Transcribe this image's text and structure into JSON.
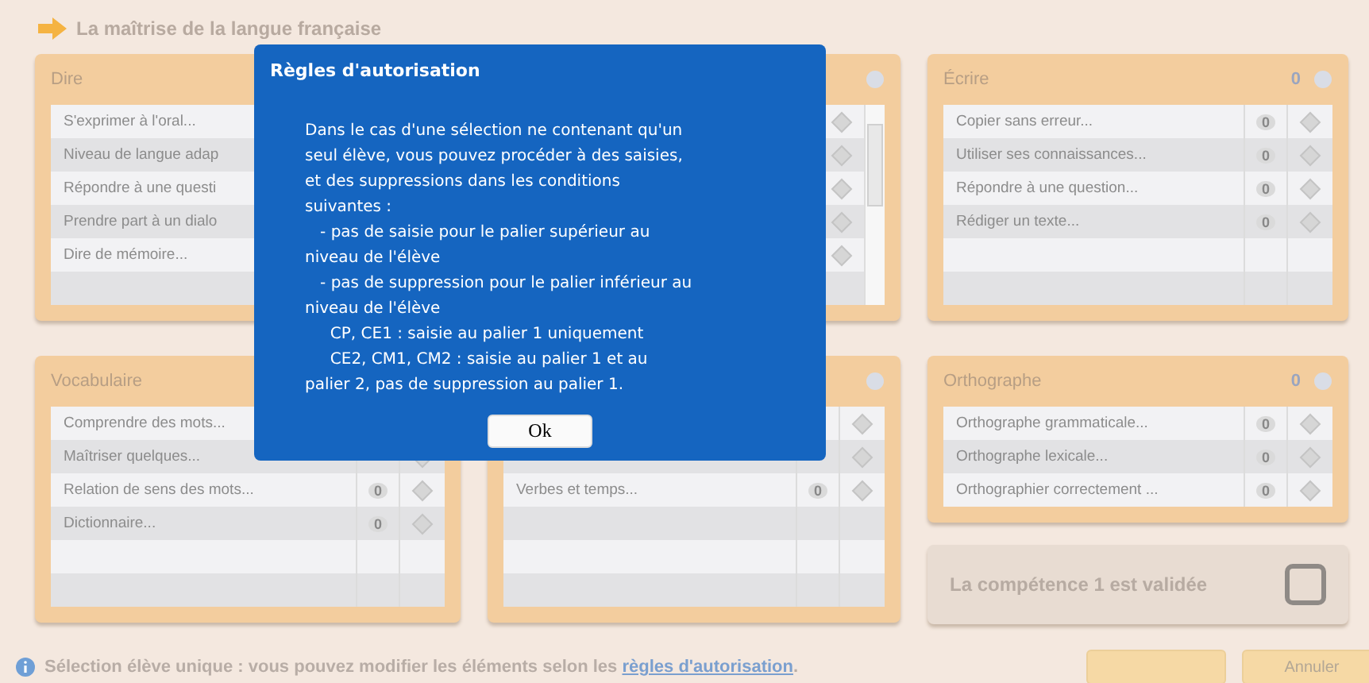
{
  "header": {
    "title": "La maîtrise de la langue française"
  },
  "panels": [
    {
      "title": "Dire",
      "kind": "long",
      "rows": [
        {
          "label": "S'exprimer à l'oral..."
        },
        {
          "label": "Niveau de langue adap"
        },
        {
          "label": "Répondre à une questi"
        },
        {
          "label": "Prendre part à un dialo"
        },
        {
          "label": "Dire de mémoire..."
        }
      ]
    },
    {
      "kind": "scroll",
      "rows": [
        {},
        {},
        {},
        {},
        {}
      ]
    },
    {
      "title": "Écrire",
      "kind": "long",
      "count": "0",
      "rows": [
        {
          "label": "Copier sans erreur...",
          "count": "0"
        },
        {
          "label": "Utiliser ses connaissances...",
          "count": "0"
        },
        {
          "label": "Répondre à une question...",
          "count": "0"
        },
        {
          "label": "Rédiger un texte...",
          "count": "0"
        }
      ]
    },
    {
      "title": "Vocabulaire",
      "kind": "long",
      "rows": [
        {
          "label": "Comprendre des mots..."
        },
        {
          "label": "Maîtriser quelques..."
        },
        {
          "label": "Relation de sens des mots...",
          "count": "0"
        },
        {
          "label": "Dictionnaire...",
          "count": "0"
        }
      ]
    },
    {
      "kind": "long",
      "rows": [
        {},
        {},
        {
          "label": "Verbes et temps...",
          "count": "0"
        }
      ]
    },
    {
      "title": "Orthographe",
      "kind": "short",
      "count": "0",
      "rows": [
        {
          "label": "Orthographe grammaticale...",
          "count": "0"
        },
        {
          "label": "Orthographe lexicale...",
          "count": "0"
        },
        {
          "label": "Orthographier correctement ...",
          "count": "0"
        }
      ]
    }
  ],
  "validation": {
    "label": "La compétence 1 est validée",
    "checked": false
  },
  "footer": {
    "text": "Sélection élève unique : vous pouvez modifier les éléments selon les",
    "link": "règles d'autorisation",
    "after": "."
  },
  "buttons": [
    {
      "kind": "blank"
    },
    {
      "kind": "text",
      "label": "Annuler"
    }
  ],
  "dialog": {
    "title": "Règles d'autorisation",
    "body": "Dans le cas d'une sélection ne contenant qu'un\nseul élève, vous pouvez procéder à des saisies,\net des suppressions dans les conditions\nsuivantes :\n   - pas de saisie pour le palier supérieur au\nniveau de l'élève\n   - pas de suppression pour le palier inférieur au\nniveau de l'élève\n     CP, CE1 : saisie au palier 1 uniquement\n     CE2, CM1, CM2 : saisie au palier 1 et au\npalier 2, pas de suppression au palier 1.",
    "ok": "Ok"
  }
}
